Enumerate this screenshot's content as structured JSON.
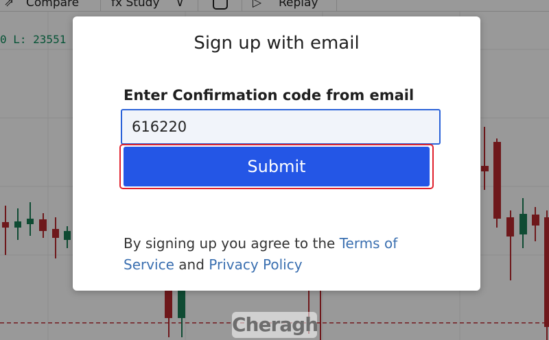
{
  "toolbar": {
    "compare_label": "Compare",
    "study_label": "fx Study",
    "replay_label": "Replay"
  },
  "chart": {
    "ohlc_readout": "0 L: 23551"
  },
  "watermark": {
    "text": "Cheragh"
  },
  "modal": {
    "title": "Sign up with email",
    "code_label": "Enter Confirmation code from email",
    "code_value": "616220",
    "submit_label": "Submit",
    "terms_prefix": "By signing up you agree to the ",
    "terms_link": "Terms of Service",
    "terms_and": " and ",
    "privacy_link": "Privacy Policy"
  },
  "colors": {
    "up_candle": "#1a7d56",
    "down_candle": "#b8292d",
    "primary_button": "#2456e6",
    "highlight_border": "#e0202c",
    "link": "#3a6fb0"
  }
}
